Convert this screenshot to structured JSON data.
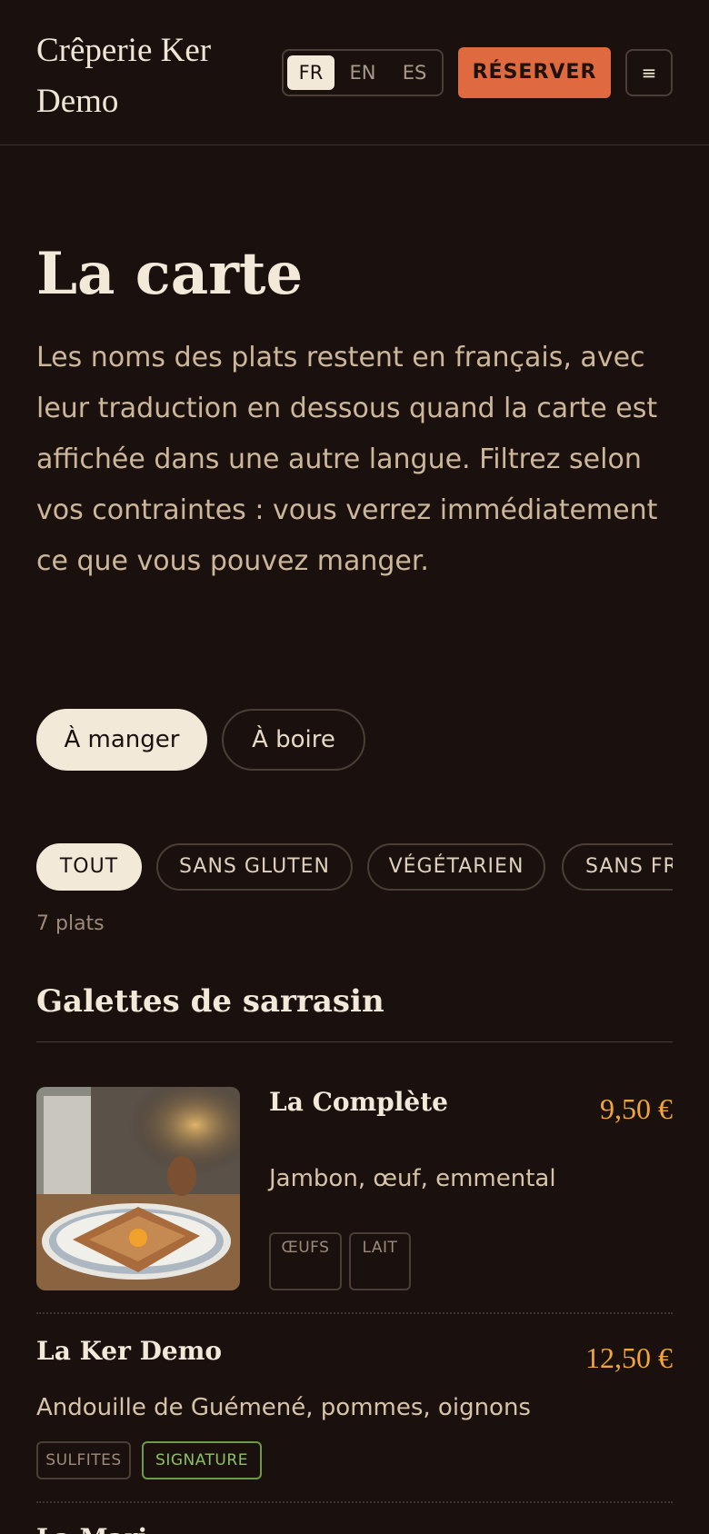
{
  "header": {
    "brand": "Crêperie Ker Demo",
    "languages": [
      "FR",
      "EN",
      "ES"
    ],
    "active_language": "FR",
    "reserve_label": "RÉSERVER",
    "menu_icon": "≡"
  },
  "hero": {
    "title": "La carte",
    "intro": "Les noms des plats restent en français, avec leur traduction en dessous quand la carte est affichée dans une autre langue. Filtrez selon vos contraintes : vous verrez immédiatement ce que vous pouvez manger."
  },
  "modes": [
    {
      "label": "À manger",
      "active": true
    },
    {
      "label": "À boire",
      "active": false
    }
  ],
  "filters": [
    {
      "label": "TOUT",
      "active": true
    },
    {
      "label": "SANS GLUTEN",
      "active": false
    },
    {
      "label": "VÉGÉTARIEN",
      "active": false
    },
    {
      "label": "SANS FR",
      "active": false
    }
  ],
  "count_label": "7 plats",
  "sections": [
    {
      "title": "Galettes de sarrasin",
      "dishes": [
        {
          "name": "La Complète",
          "price": "9,50 €",
          "description": "Jambon, œuf, emmental",
          "tags": [
            "ŒUFS",
            "LAIT"
          ]
        },
        {
          "name": "La Ker Demo",
          "price": "12,50 €",
          "description": "Andouille de Guémené, pommes, oignons",
          "tags": [
            "SULFITES",
            "SIGNATURE"
          ]
        },
        {
          "name": "La Mari",
          "price": "",
          "description": "",
          "tags": []
        }
      ]
    }
  ],
  "colors": {
    "background": "#1a110e",
    "accent": "#e06a40",
    "price": "#f0a53a",
    "signature": "#8dbf63"
  }
}
